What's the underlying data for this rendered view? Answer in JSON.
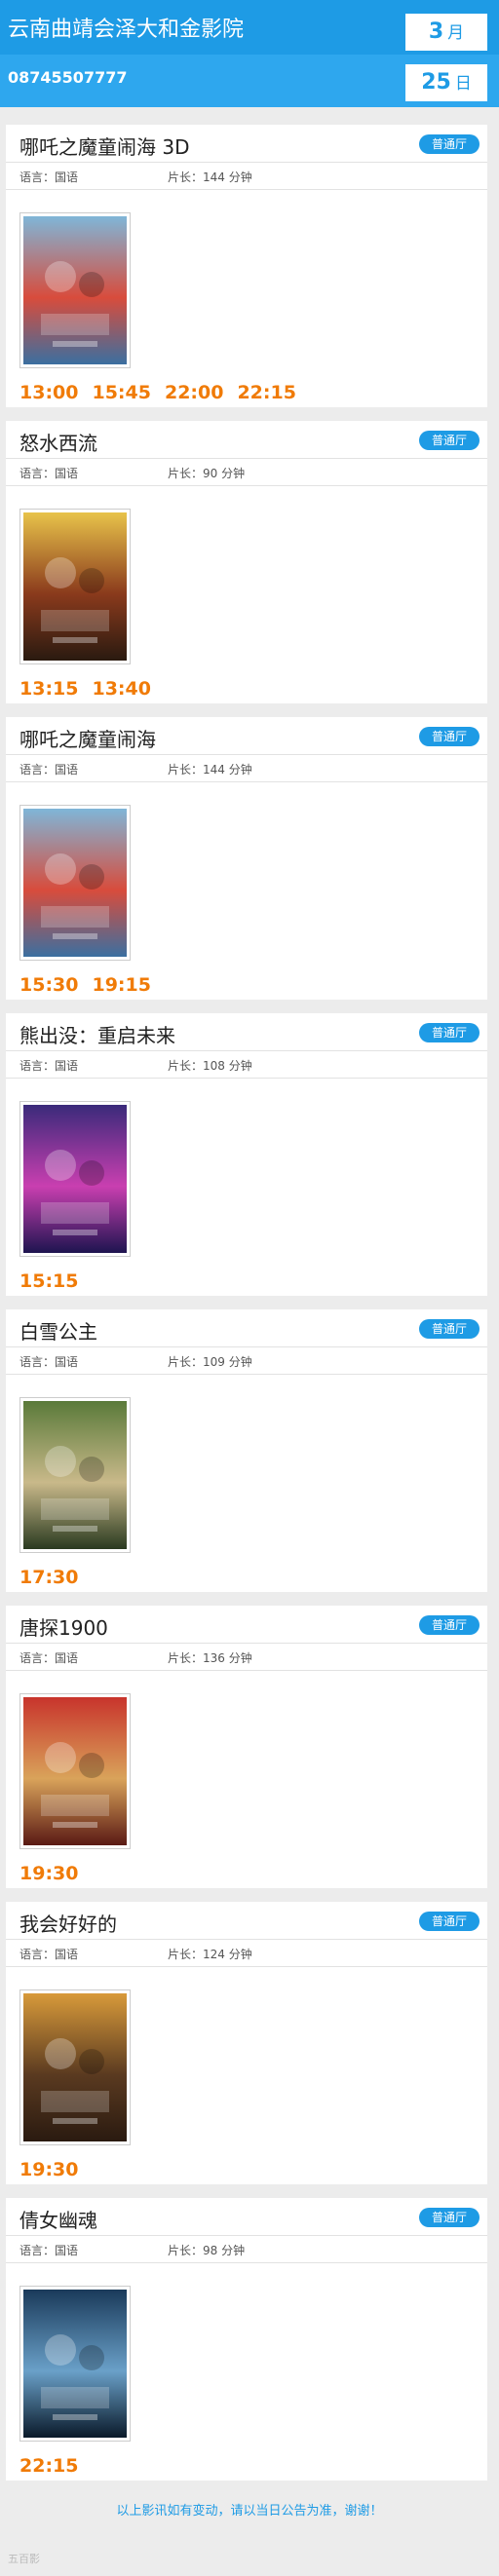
{
  "header": {
    "cinema_name": "云南曲靖会泽大和金影院",
    "phone": "08745507777",
    "month": {
      "num": "3",
      "unit": "月"
    },
    "day": {
      "num": "25",
      "unit": "日"
    }
  },
  "labels": {
    "lang_prefix": "语言：",
    "dur_prefix": "片长：",
    "dur_suffix": " 分钟"
  },
  "movies": [
    {
      "title": "哪吒之魔童闹海 3D",
      "hall": "普通厅",
      "lang": "国语",
      "duration": "144",
      "showtimes": [
        "13:00",
        "15:45",
        "22:00",
        "22:15"
      ],
      "poster_colors": [
        "#7fb6d8",
        "#d84c3c",
        "#3b6fa0"
      ]
    },
    {
      "title": "怒水西流",
      "hall": "普通厅",
      "lang": "国语",
      "duration": "90",
      "showtimes": [
        "13:15",
        "13:40"
      ],
      "poster_colors": [
        "#e8c34a",
        "#8a3a1c",
        "#2a1a10"
      ]
    },
    {
      "title": "哪吒之魔童闹海",
      "hall": "普通厅",
      "lang": "国语",
      "duration": "144",
      "showtimes": [
        "15:30",
        "19:15"
      ],
      "poster_colors": [
        "#7fb6d8",
        "#d84c3c",
        "#3b6fa0"
      ]
    },
    {
      "title": "熊出没：重启未来",
      "hall": "普通厅",
      "lang": "国语",
      "duration": "108",
      "showtimes": [
        "15:15"
      ],
      "poster_colors": [
        "#3a2a7a",
        "#c93fb0",
        "#1e1450"
      ]
    },
    {
      "title": "白雪公主",
      "hall": "普通厅",
      "lang": "国语",
      "duration": "109",
      "showtimes": [
        "17:30"
      ],
      "poster_colors": [
        "#5a7a3a",
        "#c9b98a",
        "#2a3a20"
      ]
    },
    {
      "title": "唐探1900",
      "hall": "普通厅",
      "lang": "国语",
      "duration": "136",
      "showtimes": [
        "19:30"
      ],
      "poster_colors": [
        "#c8342c",
        "#d9a35a",
        "#5a1a14"
      ]
    },
    {
      "title": "我会好好的",
      "hall": "普通厅",
      "lang": "国语",
      "duration": "124",
      "showtimes": [
        "19:30"
      ],
      "poster_colors": [
        "#d89a3a",
        "#5a3a20",
        "#2a1a10"
      ]
    },
    {
      "title": "倩女幽魂",
      "hall": "普通厅",
      "lang": "国语",
      "duration": "98",
      "showtimes": [
        "22:15"
      ],
      "poster_colors": [
        "#1a3a5a",
        "#6aa0c8",
        "#0a1a2a"
      ]
    }
  ],
  "footer": {
    "notice": "以上影讯如有变动，请以当日公告为准，谢谢！",
    "watermark": "五百影"
  }
}
